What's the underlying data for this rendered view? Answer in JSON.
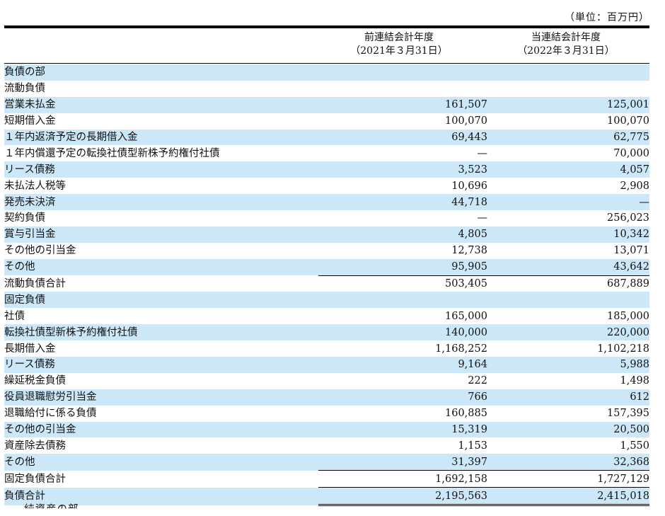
{
  "unit_label": "（単位：百万円）",
  "headers": {
    "prev": {
      "line1": "前連結会計年度",
      "line2": "（2021年３月31日）"
    },
    "curr": {
      "line1": "当連結会計年度",
      "line2": "（2022年３月31日）"
    }
  },
  "rows": [
    {
      "label": "負債の部",
      "prev": "",
      "curr": ""
    },
    {
      "label": "流動負債",
      "prev": "",
      "curr": ""
    },
    {
      "label": "営業未払金",
      "prev": "161,507",
      "curr": "125,001"
    },
    {
      "label": "短期借入金",
      "prev": "100,070",
      "curr": "100,070"
    },
    {
      "label": "１年内返済予定の長期借入金",
      "prev": "69,443",
      "curr": "62,775"
    },
    {
      "label": "１年内償還予定の転換社債型新株予約権付社債",
      "prev": "—",
      "curr": "70,000"
    },
    {
      "label": "リース債務",
      "prev": "3,523",
      "curr": "4,057"
    },
    {
      "label": "未払法人税等",
      "prev": "10,696",
      "curr": "2,908"
    },
    {
      "label": "発売未決済",
      "prev": "44,718",
      "curr": "—"
    },
    {
      "label": "契約負債",
      "prev": "—",
      "curr": "256,023"
    },
    {
      "label": "賞与引当金",
      "prev": "4,805",
      "curr": "10,342"
    },
    {
      "label": "その他の引当金",
      "prev": "12,738",
      "curr": "13,071"
    },
    {
      "label": "その他",
      "prev": "95,905",
      "curr": "43,642"
    },
    {
      "label": "流動負債合計",
      "prev": "503,405",
      "curr": "687,889"
    },
    {
      "label": "固定負債",
      "prev": "",
      "curr": ""
    },
    {
      "label": "社債",
      "prev": "165,000",
      "curr": "185,000"
    },
    {
      "label": "転換社債型新株予約権付社債",
      "prev": "140,000",
      "curr": "220,000"
    },
    {
      "label": "長期借入金",
      "prev": "1,168,252",
      "curr": "1,102,218"
    },
    {
      "label": "リース債務",
      "prev": "9,164",
      "curr": "5,988"
    },
    {
      "label": "繰延税金負債",
      "prev": "222",
      "curr": "1,498"
    },
    {
      "label": "役員退職慰労引当金",
      "prev": "766",
      "curr": "612"
    },
    {
      "label": "退職給付に係る負債",
      "prev": "160,885",
      "curr": "157,395"
    },
    {
      "label": "その他の引当金",
      "prev": "15,319",
      "curr": "20,500"
    },
    {
      "label": "資産除去債務",
      "prev": "1,153",
      "curr": "1,550"
    },
    {
      "label": "その他",
      "prev": "31,397",
      "curr": "32,368"
    },
    {
      "label": "固定負債合計",
      "prev": "1,692,158",
      "curr": "1,727,129"
    },
    {
      "label": "負債合計",
      "prev": "2,195,563",
      "curr": "2,415,018"
    }
  ],
  "footer_partial": "純資産の部",
  "colors": {
    "row_shade": "#cce8f8",
    "rule": "#000000"
  }
}
